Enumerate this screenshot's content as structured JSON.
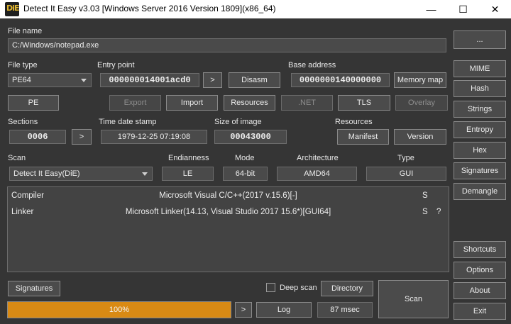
{
  "window": {
    "app_icon_text": "DiE",
    "title": "Detect It Easy v3.03 [Windows Server 2016 Version 1809](x86_64)",
    "minimize_glyph": "—",
    "maximize_glyph": "☐",
    "close_glyph": "✕"
  },
  "file": {
    "label": "File name",
    "path": "C:/Windows/notepad.exe",
    "browse_label": "..."
  },
  "info": {
    "file_type_label": "File type",
    "file_type_value": "PE64",
    "entry_point_label": "Entry point",
    "entry_point_value": "000000014001acd0",
    "entry_point_go": ">",
    "disasm_label": "Disasm",
    "base_address_label": "Base address",
    "base_address_value": "0000000140000000",
    "memory_map_label": "Memory map",
    "sections_label": "Sections",
    "sections_value": "0006",
    "sections_go": ">",
    "time_date_stamp_label": "Time date stamp",
    "time_date_stamp_value": "1979-12-25 07:19:08",
    "size_of_image_label": "Size of image",
    "size_of_image_value": "00043000",
    "resources_label": "Resources"
  },
  "toolbar": {
    "pe": "PE",
    "export": "Export",
    "import": "Import",
    "resources": "Resources",
    "net": ".NET",
    "tls": "TLS",
    "overlay": "Overlay",
    "manifest": "Manifest",
    "version": "Version"
  },
  "scan": {
    "label": "Scan",
    "engine": "Detect It Easy(DiE)",
    "endianness_label": "Endianness",
    "endianness_value": "LE",
    "mode_label": "Mode",
    "mode_value": "64-bit",
    "architecture_label": "Architecture",
    "architecture_value": "AMD64",
    "type_label": "Type",
    "type_value": "GUI"
  },
  "results": [
    {
      "type": "Compiler",
      "name": "Microsoft Visual C/C++(2017 v.15.6)[-]",
      "flag": "S",
      "extra": ""
    },
    {
      "type": "Linker",
      "name": "Microsoft Linker(14.13, Visual Studio 2017 15.6*)[GUI64]",
      "flag": "S",
      "extra": "?"
    }
  ],
  "sidebar": {
    "mime": "MIME",
    "hash": "Hash",
    "strings": "Strings",
    "entropy": "Entropy",
    "hex": "Hex",
    "signatures": "Signatures",
    "demangle": "Demangle",
    "shortcuts": "Shortcuts",
    "options": "Options",
    "about": "About",
    "exit": "Exit"
  },
  "bottom": {
    "signatures": "Signatures",
    "deep_scan": "Deep scan",
    "deep_scan_checked": false,
    "directory": "Directory",
    "scan": "Scan",
    "progress_text": "100%",
    "progress_fraction": 1.0,
    "progress_color": "#d98a14",
    "go": ">",
    "log": "Log",
    "time": "87 msec"
  }
}
